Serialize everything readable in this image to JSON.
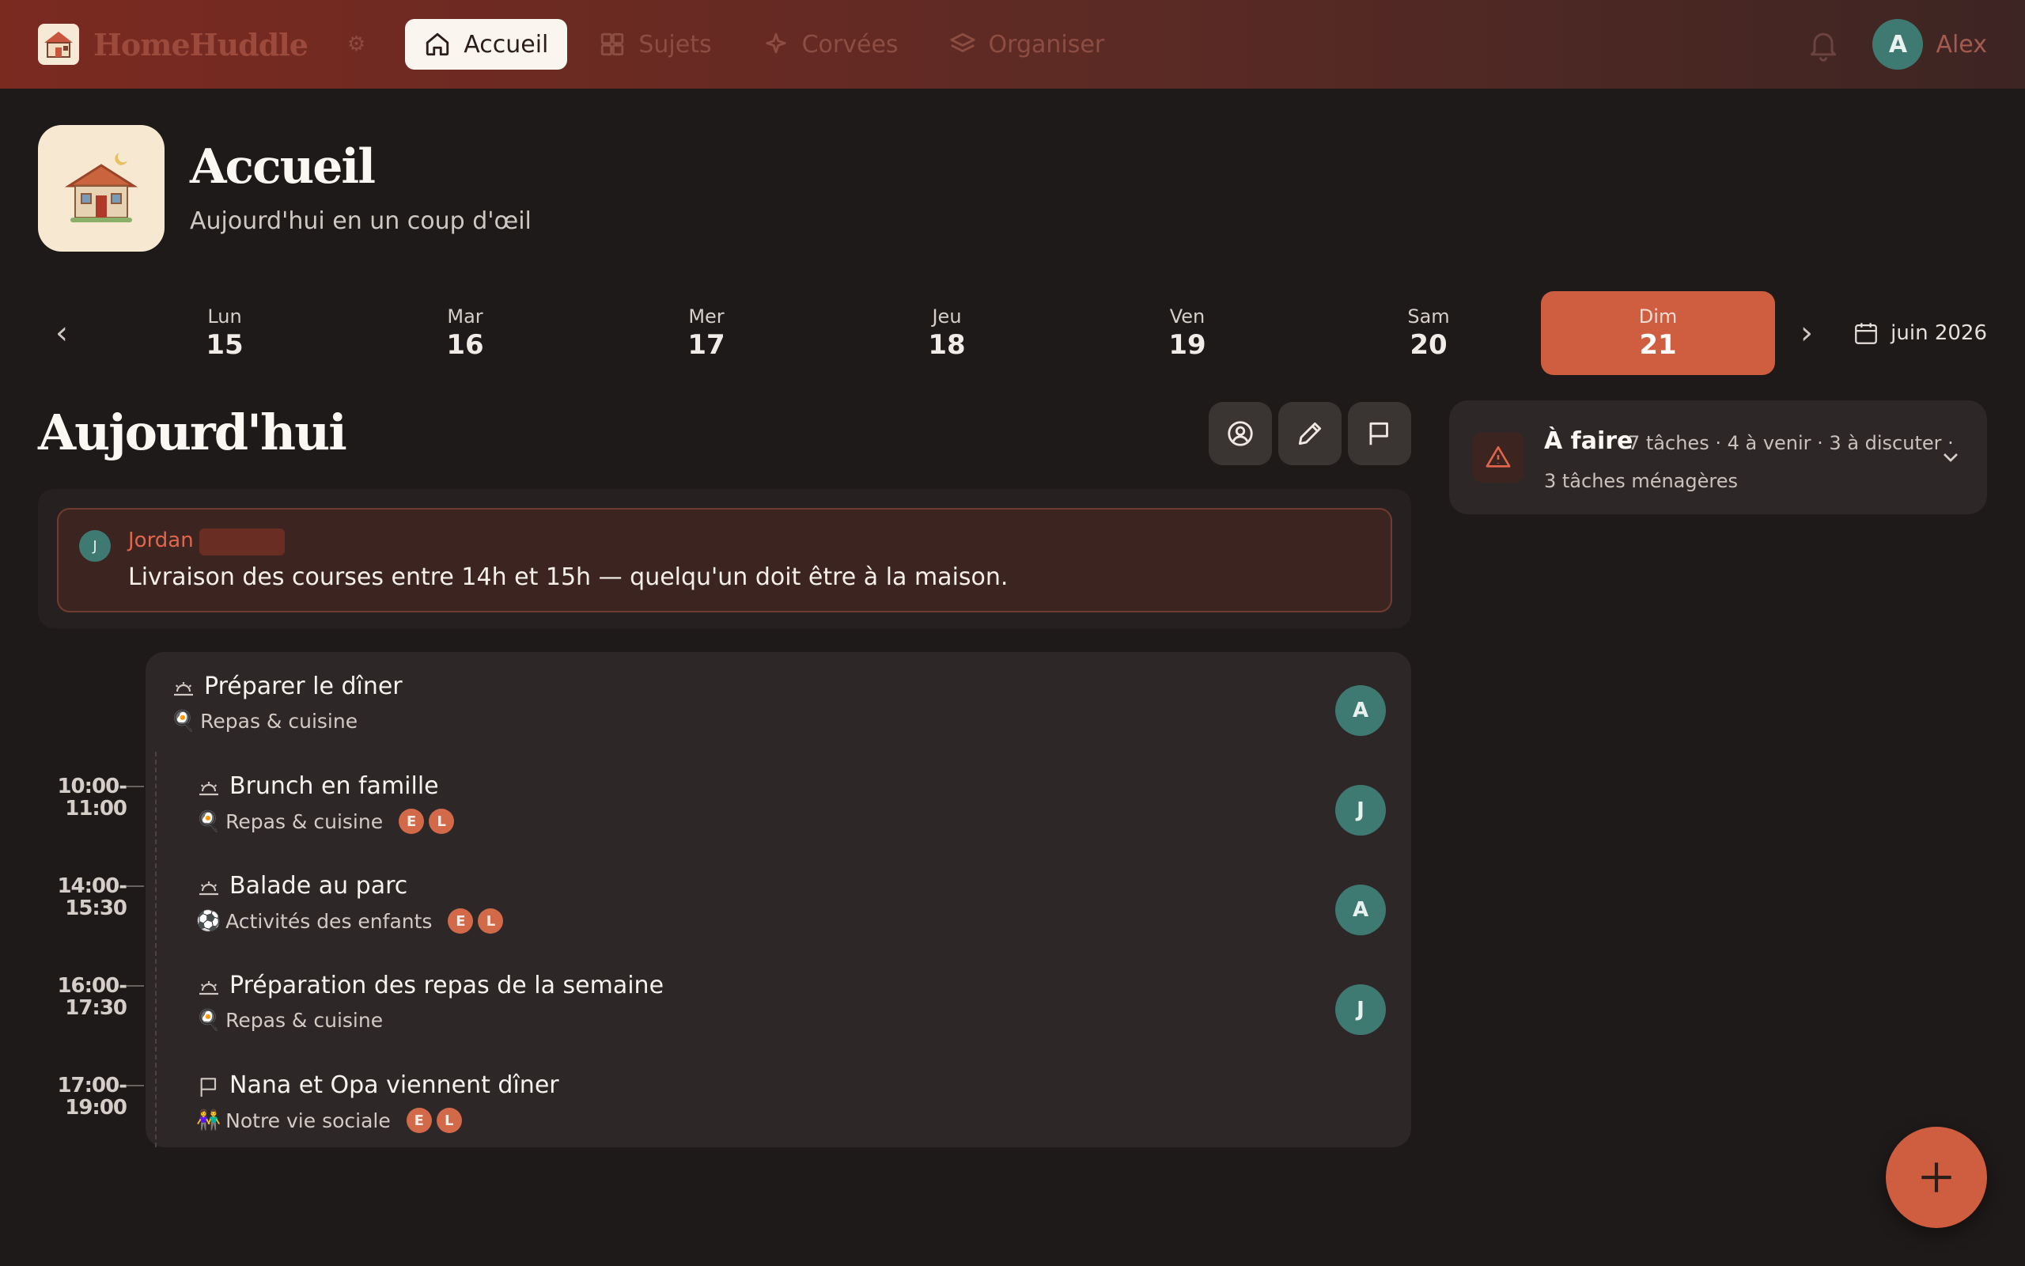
{
  "app": {
    "name": "HomeHuddle",
    "accent": "#cf5d3f"
  },
  "nav": {
    "items": [
      {
        "label": "Accueil",
        "icon": "home-icon",
        "active": true
      },
      {
        "label": "Sujets",
        "icon": "grid-icon",
        "active": false
      },
      {
        "label": "Corvées",
        "icon": "sparkle-icon",
        "active": false
      },
      {
        "label": "Organiser",
        "icon": "layers-icon",
        "active": false
      }
    ]
  },
  "user": {
    "initial": "A",
    "name": "Alex"
  },
  "header": {
    "title": "Accueil",
    "subtitle": "Aujourd'hui en un coup d'œil"
  },
  "week": {
    "days": [
      {
        "name": "Lun",
        "num": "15"
      },
      {
        "name": "Mar",
        "num": "16"
      },
      {
        "name": "Mer",
        "num": "17"
      },
      {
        "name": "Jeu",
        "num": "18"
      },
      {
        "name": "Ven",
        "num": "19"
      },
      {
        "name": "Sam",
        "num": "20"
      },
      {
        "name": "Dim",
        "num": "21"
      }
    ],
    "selected_index": 6,
    "month": "juin 2026"
  },
  "today": {
    "title": "Aujourd'hui"
  },
  "note": {
    "author_initial": "J",
    "author": "Jordan",
    "text": "Livraison des courses entre 14h et 15h — quelqu'un doit être à la maison."
  },
  "events": [
    {
      "time_start": "",
      "time_end": "",
      "icon": "sunrise-icon",
      "title": "Préparer le dîner",
      "cat_emoji": "🍳",
      "category": "Repas & cuisine",
      "chips": [],
      "assignee": "A"
    },
    {
      "time_start": "10:00-",
      "time_end": "11:00",
      "icon": "sunrise-icon",
      "title": "Brunch en famille",
      "cat_emoji": "🍳",
      "category": "Repas & cuisine",
      "chips": [
        "E",
        "L"
      ],
      "assignee": "J"
    },
    {
      "time_start": "14:00-",
      "time_end": "15:30",
      "icon": "sunrise-icon",
      "title": "Balade au parc",
      "cat_emoji": "⚽",
      "category": "Activités des enfants",
      "chips": [
        "E",
        "L"
      ],
      "assignee": "A"
    },
    {
      "time_start": "16:00-",
      "time_end": "17:30",
      "icon": "sunrise-icon",
      "title": "Préparation des repas de la semaine",
      "cat_emoji": "🍳",
      "category": "Repas & cuisine",
      "chips": [],
      "assignee": "J"
    },
    {
      "time_start": "17:00-",
      "time_end": "19:00",
      "icon": "flag-icon",
      "title": "Nana et Opa viennent dîner",
      "cat_emoji": "👫",
      "category": "Notre vie sociale",
      "chips": [
        "E",
        "L"
      ],
      "assignee": ""
    }
  ],
  "todo": {
    "title": "À faire",
    "summary_line1": "7 tâches · 4 à venir · 3 à discuter ·",
    "summary_line2": "3 tâches ménagères"
  }
}
